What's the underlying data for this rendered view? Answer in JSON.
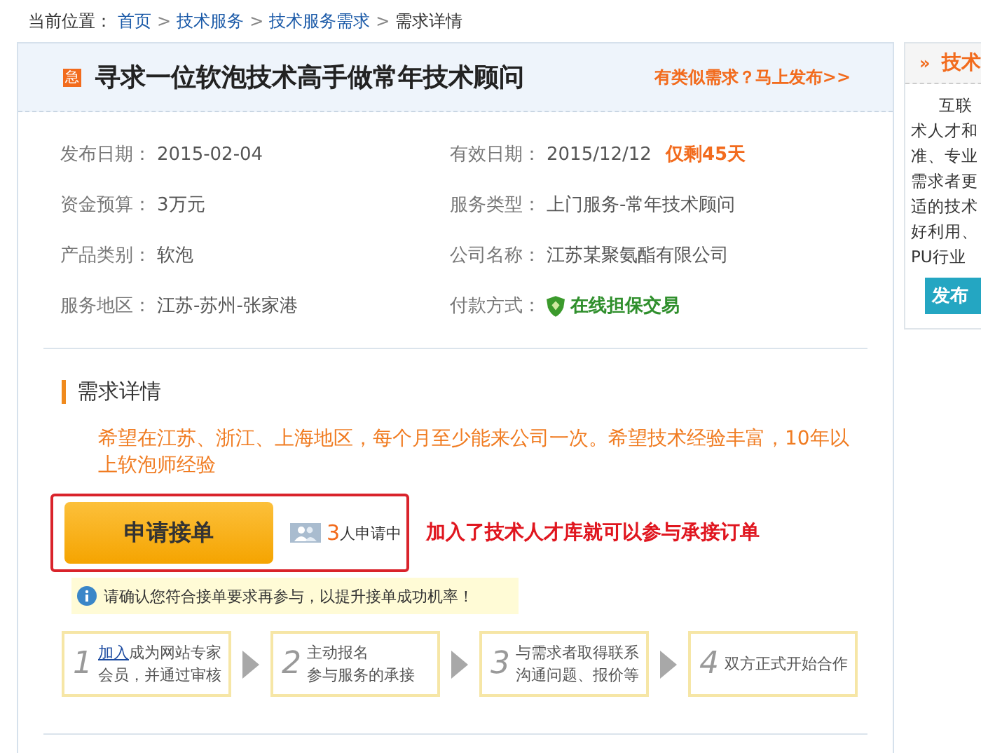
{
  "breadcrumb": {
    "label": "当前位置：",
    "items": [
      {
        "text": "首页",
        "link": true
      },
      {
        "text": "技术服务",
        "link": true
      },
      {
        "text": "技术服务需求",
        "link": true
      },
      {
        "text": "需求详情",
        "link": false
      }
    ],
    "separator": ">"
  },
  "header": {
    "badge": "急",
    "title": "寻求一位软泡技术高手做常年技术顾问",
    "action": "有类似需求？马上发布>>"
  },
  "fields": [
    {
      "label": "发布日期：",
      "value": "2015-02-04"
    },
    {
      "label": "有效日期：",
      "value": "2015/12/12",
      "note": "仅剩45天"
    },
    {
      "label": "资金预算：",
      "value": "3万元"
    },
    {
      "label": "服务类型：",
      "value": "上门服务-常年技术顾问"
    },
    {
      "label": "产品类别：",
      "value": "软泡"
    },
    {
      "label": "公司名称：",
      "value": "江苏某聚氨酯有限公司"
    },
    {
      "label": "服务地区：",
      "value": "江苏-苏州-张家港"
    },
    {
      "label": "付款方式：",
      "value": "在线担保交易",
      "kind": "secure"
    }
  ],
  "section": {
    "title": "需求详情",
    "description": "希望在江苏、浙江、上海地区，每个月至少能来公司一次。希望技术经验丰富，10年以上软泡师经验"
  },
  "apply": {
    "button": "申请接单",
    "count": "3",
    "count_text": "人申请中",
    "annotation": "加入了技术人才库就可以参与承接订单"
  },
  "notice": "请确认您符合接单要求再参与，以提升接单成功机率！",
  "steps": [
    {
      "num": "1",
      "link": "加入",
      "lines": [
        "成为网站专家",
        "会员，并通过审核"
      ]
    },
    {
      "num": "2",
      "lines": [
        "主动报名",
        "参与服务的承接"
      ]
    },
    {
      "num": "3",
      "lines": [
        "与需求者取得联系",
        "沟通问题、报价等"
      ]
    },
    {
      "num": "4",
      "lines": [
        "双方正式开始合作"
      ]
    }
  ],
  "side": {
    "icon": "»",
    "title": "技术",
    "lines": [
      "互联",
      "术人才和",
      "准、专业",
      "需求者更",
      "适的技术",
      "好利用、",
      "PU行业"
    ],
    "button": "发布"
  }
}
